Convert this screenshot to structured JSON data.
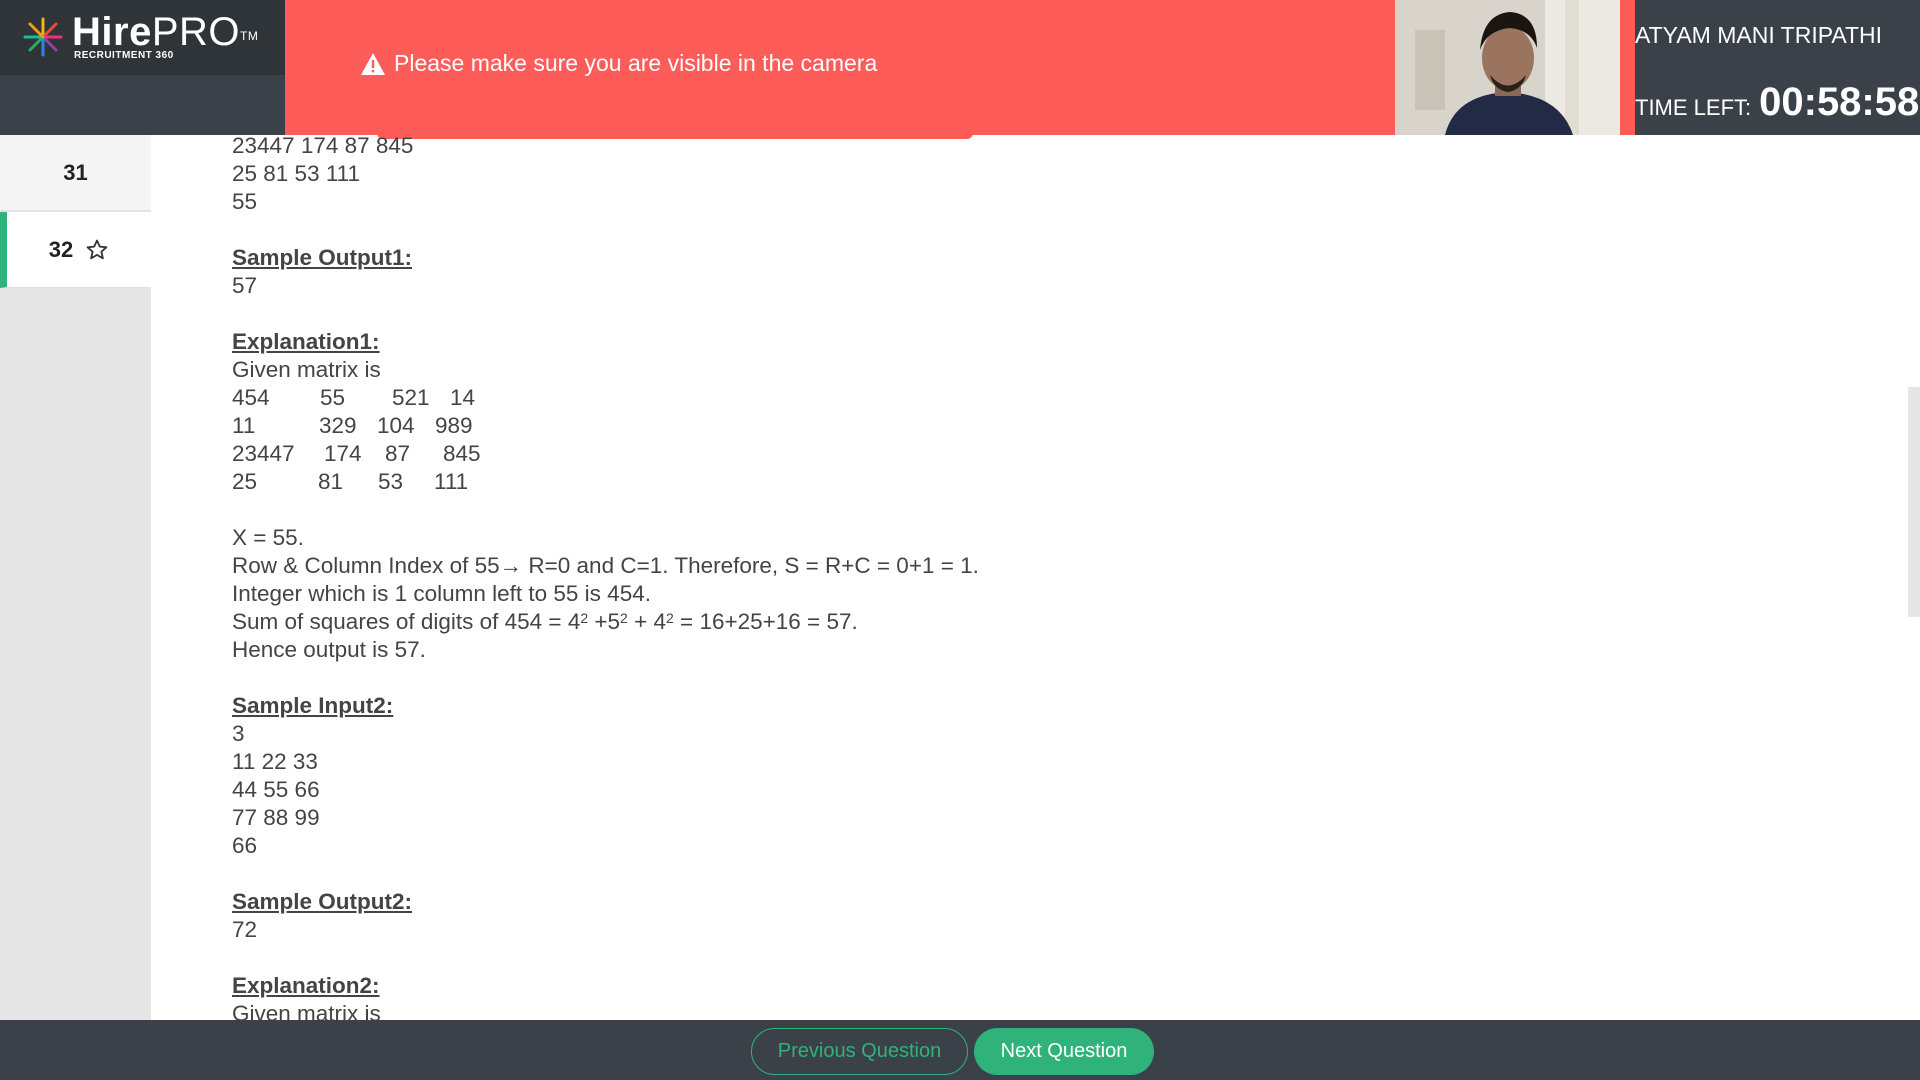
{
  "brand": {
    "name_bold": "Hire",
    "name_light": "PRO",
    "trademark": "TM",
    "subtitle": "RECRUITMENT 360"
  },
  "alert": {
    "icon": "warning-triangle-icon",
    "message": "Please make sure you are visible in the camera",
    "color": "#fd5c58"
  },
  "user": {
    "name": "ATYAM MANI TRIPATHI",
    "time_label": "TIME LEFT:",
    "time_value": "00:58:58"
  },
  "sidebar": {
    "items": [
      {
        "number": "31"
      },
      {
        "number": "32",
        "active": true,
        "icon": "star-outline-icon"
      }
    ]
  },
  "content": {
    "input1_tail": [
      "23447 174 87 845",
      "25 81 53 111",
      "55"
    ],
    "sample_output1_heading": "Sample Output1:",
    "sample_output1_value": "57",
    "explanation1_heading": "Explanation1:",
    "explanation1_intro": "Given matrix is",
    "matrix1": [
      [
        "454",
        "55",
        "521",
        "14"
      ],
      [
        "11",
        "329",
        "104",
        "989"
      ],
      [
        "23447",
        "174",
        "87",
        "845"
      ],
      [
        "25",
        "81",
        "53",
        "111"
      ]
    ],
    "x_line": "X = 55.",
    "index_line": "Row & Column Index of 55→ R=0 and C=1. Therefore, S = R+C = 0+1 = 1.",
    "left_line": "Integer which is 1 column left to 55 is 454.",
    "sum_prefix": "Sum of squares of digits of 454 = 4",
    "sum_part2": " +5",
    "sum_part3": " + 4",
    "sum_suffix": " = 16+25+16 = 57.",
    "exponent": "2",
    "hence_line": "Hence output is 57.",
    "sample_input2_heading": "Sample Input2:",
    "input2": [
      "3",
      "11 22 33",
      "44 55 66",
      "77 88 99",
      "66"
    ],
    "sample_output2_heading": "Sample Output2:",
    "sample_output2_value": "72",
    "explanation2_heading": "Explanation2:",
    "explanation2_intro": "Given matrix is"
  },
  "footer": {
    "prev_label": "Previous Question",
    "next_label": "Next Question",
    "accent": "#2fb37a"
  }
}
